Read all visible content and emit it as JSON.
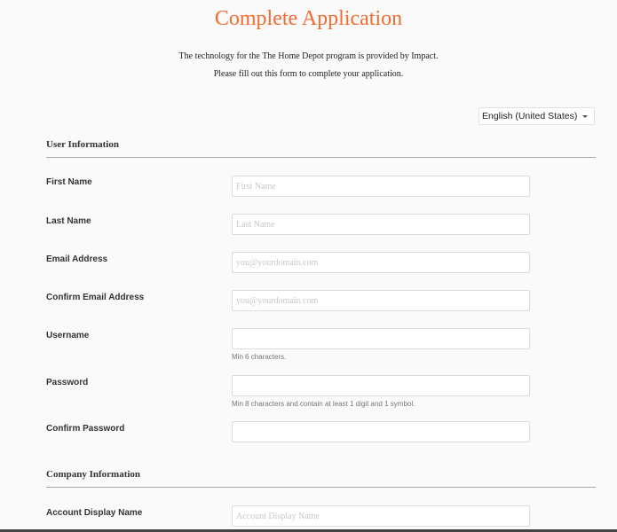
{
  "page": {
    "title": "Complete Application",
    "intro_line1": "The technology for the The Home Depot program is provided by Impact.",
    "intro_line2": "Please fill out this form to complete your application."
  },
  "language_select": {
    "selected": "English (United States)",
    "icon": "caret-down-icon"
  },
  "sections": {
    "user_info": {
      "title": "User Information"
    },
    "company_info": {
      "title": "Company Information"
    }
  },
  "fields": {
    "first_name": {
      "label": "First Name",
      "placeholder": "First Name",
      "value": ""
    },
    "last_name": {
      "label": "Last Name",
      "placeholder": "Last Name",
      "value": ""
    },
    "email": {
      "label": "Email Address",
      "placeholder": "you@yourdomain.com",
      "value": ""
    },
    "confirm_email": {
      "label": "Confirm Email Address",
      "placeholder": "you@yourdomain.com",
      "value": ""
    },
    "username": {
      "label": "Username",
      "placeholder": "",
      "value": "",
      "help": "Min 6 characters."
    },
    "password": {
      "label": "Password",
      "placeholder": "",
      "value": "",
      "help": "Min 8 characters and contain at least 1 digit and 1 symbol."
    },
    "confirm_password": {
      "label": "Confirm Password",
      "placeholder": "",
      "value": ""
    },
    "account_display_name": {
      "label": "Account Display Name",
      "placeholder": "Account Display Name",
      "value": ""
    }
  },
  "colors": {
    "title": "#f26c31",
    "background": "#fafafa",
    "divider": "#a8a8a8"
  }
}
